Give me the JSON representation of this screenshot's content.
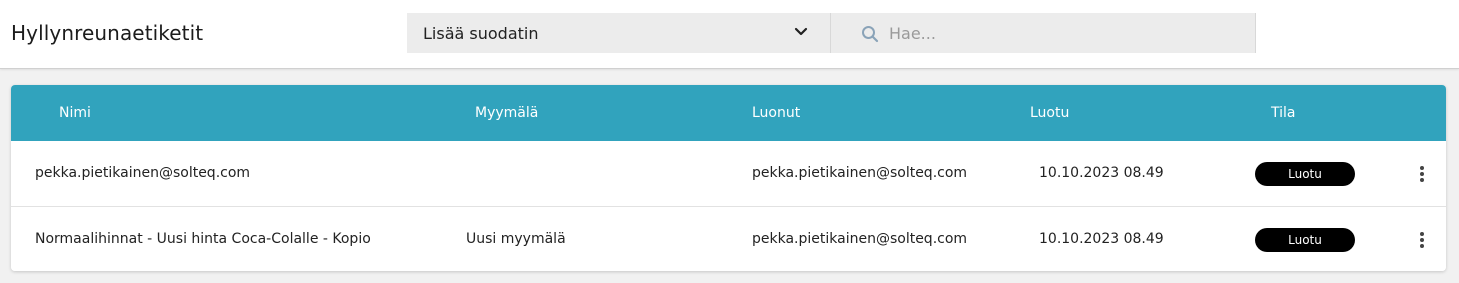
{
  "header": {
    "title": "Hyllynreunaetiketit",
    "filter_label": "Lisää suodatin",
    "search_placeholder": "Hae..."
  },
  "table": {
    "columns": [
      "Nimi",
      "Myymälä",
      "Luonut",
      "Luotu",
      "Tila"
    ],
    "rows": [
      {
        "name": "pekka.pietikainen@solteq.com",
        "store": "",
        "created_by": "pekka.pietikainen@solteq.com",
        "created_at": "10.10.2023 08.49",
        "status": "Luotu"
      },
      {
        "name": "Normaalihinnat - Uusi hinta Coca-Colalle - Kopio",
        "store": "Uusi myymälä",
        "created_by": "pekka.pietikainen@solteq.com",
        "created_at": "10.10.2023 08.49",
        "status": "Luotu"
      }
    ]
  },
  "icons": {
    "filter_chevron": "chevron-down-icon",
    "search": "search-icon",
    "row_menu": "more-vertical-icon"
  },
  "colors": {
    "header_accent": "#31a3bd",
    "status_badge_bg": "#000000"
  }
}
